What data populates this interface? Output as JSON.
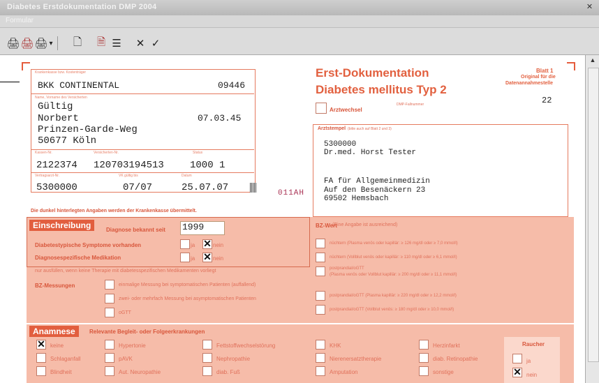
{
  "window": {
    "title": "Diabetes Erstdokumentation DMP 2004",
    "close": "✕",
    "menu": "Formular"
  },
  "toolbar": {
    "print1": "🖨",
    "print2": "🖨",
    "print3": "🖨",
    "dropdown": "▾",
    "new": "🗋",
    "preview": "🗎",
    "list": "☰",
    "cancel": "✕",
    "ok": "✓"
  },
  "form": {
    "insurer_label": "Krankenkasse bzw. Kostenträger",
    "insurer": "BKK CONTINENTAL",
    "insurer_no": "09446",
    "patient_label": "Name, Vorname des Versicherten",
    "patient_line1": "Gültig",
    "patient_line2": "Norbert",
    "birthdate": "07.03.45",
    "patient_line3": "Prinzen-Garde-Weg",
    "patient_line4": "50677 Köln",
    "kassen_label": "Kassen-Nr.",
    "kassen_no": "2122374",
    "versicherten_label": "Versicherten-Nr.",
    "versicherten_no": "120703194513",
    "status_label": "Status",
    "status": "1000 1",
    "betriebs_label": "Vertragsarzt-Nr.",
    "betriebs_no": "5300000",
    "valid_label": "VK gültig bis",
    "valid": "07/07",
    "date_label": "Datum",
    "date": "25.07.07",
    "side_code": "011AH",
    "title1": "Erst-Dokumentation",
    "title2": "Diabetes mellitus Typ 2",
    "sheet": "Blatt 1",
    "sheet_sub1": "Original für die",
    "sheet_sub2": "Datenannahmestelle",
    "sheet_no": "22",
    "arztwechsel": "Arztwechsel",
    "dmp_fallnummer": "DMP-Fallnummer",
    "arzt_label": "Arztstempel",
    "arzt_label_sub": "(bitte auch auf Blatt 2 und 3)",
    "arzt_line1": "5300000",
    "arzt_line2": "Dr.med. Horst Tester",
    "arzt_line3": "FA für Allgemeinmedizin",
    "arzt_line4": "Auf den Besenäckern 23",
    "arzt_line5": "69502 Hemsbach",
    "notice": "Die dunkel hinterlegten Angaben werden der Krankenkasse übermittelt."
  },
  "einschreibung": {
    "title": "Einschreibung",
    "diagnose_label": "Diagnose bekannt seit",
    "diagnose_year": "1999",
    "symptome": "Diabetestypische Symptome vorhanden",
    "medikation": "Diagnosespezifische Medikation",
    "ja": "ja",
    "nein": "nein",
    "hint": "nur ausfüllen, wenn keine Therapie mit diabetesspezifischen Medikamenten vorliegt",
    "bz_label": "BZ-Messungen",
    "bz1": "einmalige Messung bei symptomatischen Patienten (auffallend)",
    "bz2": "zwei- oder mehrfach Messung bei asymptomatischen Patienten",
    "bz3": "oGTT",
    "bzwert_label": "BZ-Wert",
    "bzwert_sub": "(Eine Angabe ist ausreichend)",
    "nw1": "nüchtern (Plasma venös oder kapillär: ≥ 126 mg/dl oder ≥ 7,0 mmol/l)",
    "nw2": "nüchtern (Vollblut venös oder kapillär: ≥ 110 mg/dl oder ≥ 6,1 mmol/l)",
    "nw3": "postprandial/oGTT",
    "nw3b": "(Plasma venös oder Vollblut kapillär: ≥ 200 mg/dl oder ≥ 11,1 mmol/l)",
    "nw4": "postprandial/oGTT (Plasma kapillär: ≥ 220 mg/dl oder ≥ 12,2 mmol/l)",
    "nw5": "postprandial/oGTT (Vollblut venös: ≥ 180 mg/dl oder ≥ 10,0 mmol/l)"
  },
  "anamnese": {
    "title": "Anamnese",
    "sub": "Relevante Begleit- oder Folgeerkrankungen",
    "col1": [
      "keine",
      "Schlaganfall",
      "Blindheit"
    ],
    "col2": [
      "Hypertonie",
      "pAVK",
      "Aut. Neuropathie"
    ],
    "col3": [
      "Fettstoffwechselstörung",
      "Nephropathie",
      "diab. Fuß"
    ],
    "col4": [
      "KHK",
      "Nierenersatztherapie",
      "Amputation"
    ],
    "col5": [
      "Herzinfarkt",
      "diab. Retinopathie",
      "sonstige"
    ],
    "raucher": "Raucher",
    "raucher_ja": "ja",
    "raucher_nein": "nein"
  }
}
